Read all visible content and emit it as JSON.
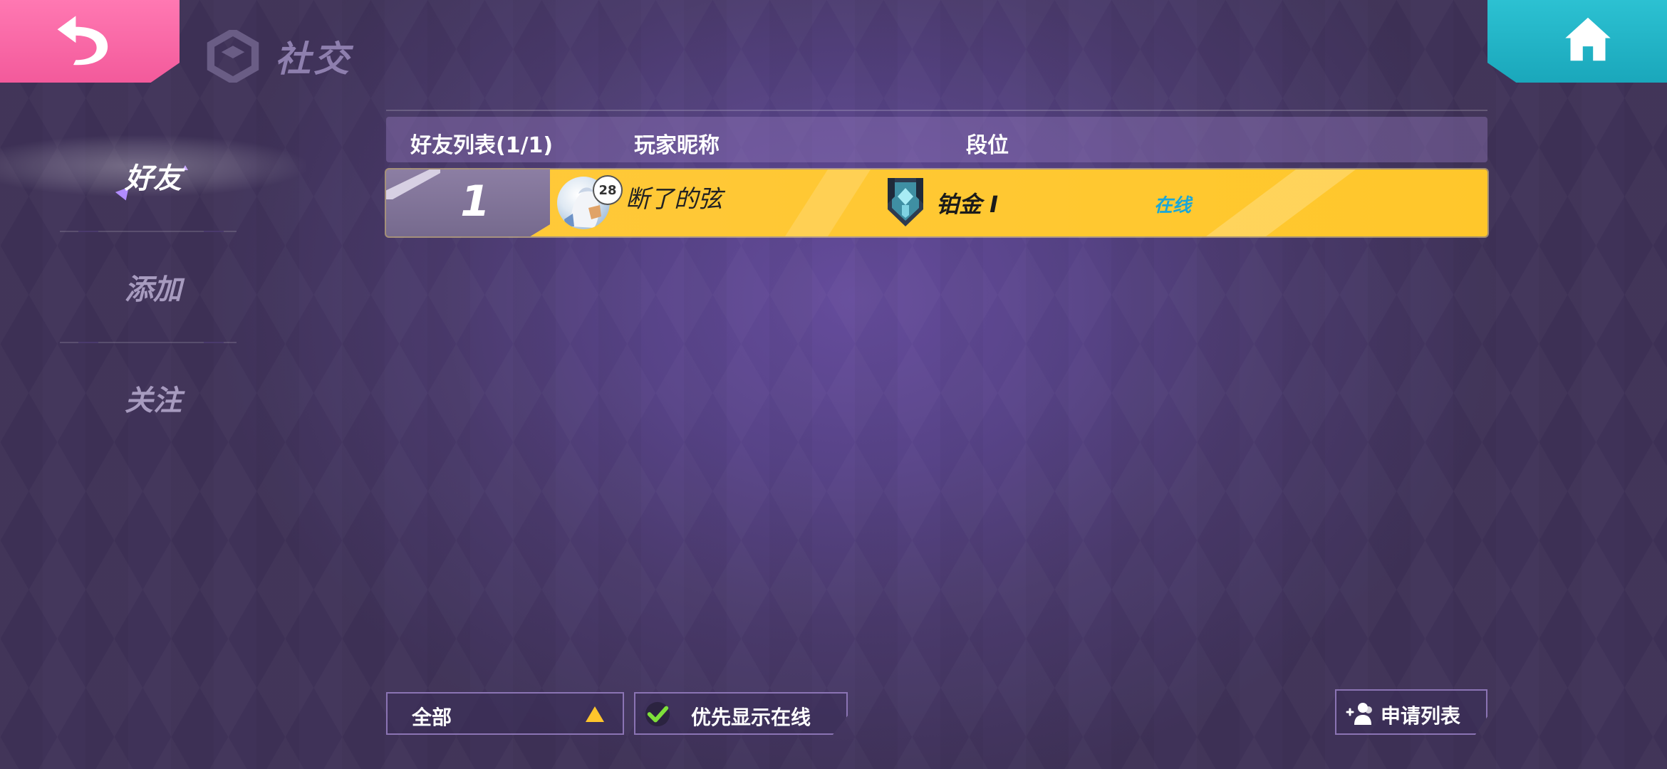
{
  "title": {
    "text": "社交"
  },
  "sidebar": {
    "items": [
      {
        "label": "好友",
        "active": true
      },
      {
        "label": "添加",
        "active": false
      },
      {
        "label": "关注",
        "active": false
      }
    ]
  },
  "table": {
    "headers": [
      "好友列表(1/1)",
      "玩家昵称",
      "段位"
    ],
    "rows": [
      {
        "rank": "1",
        "level": "28",
        "name": "断了的弦",
        "tier": "铂金 I",
        "status": "在线"
      }
    ]
  },
  "footer": {
    "filter_value": "全部",
    "online_first_label": "优先显示在线",
    "online_first_checked": true,
    "apply_list_label": "申请列表"
  },
  "colors": {
    "back_button": "#f35a9b",
    "home_button": "#1aa7bb",
    "row_highlight": "#ffc72b",
    "status_online": "#19a7d8",
    "accent_caret": "#ffc52c"
  },
  "icons": {
    "back": "undo-arrow-icon",
    "home": "house-icon",
    "title": "social-logo-icon",
    "rank": "platinum-shield-icon",
    "check": "checkmark-icon",
    "apply": "add-user-icon"
  }
}
